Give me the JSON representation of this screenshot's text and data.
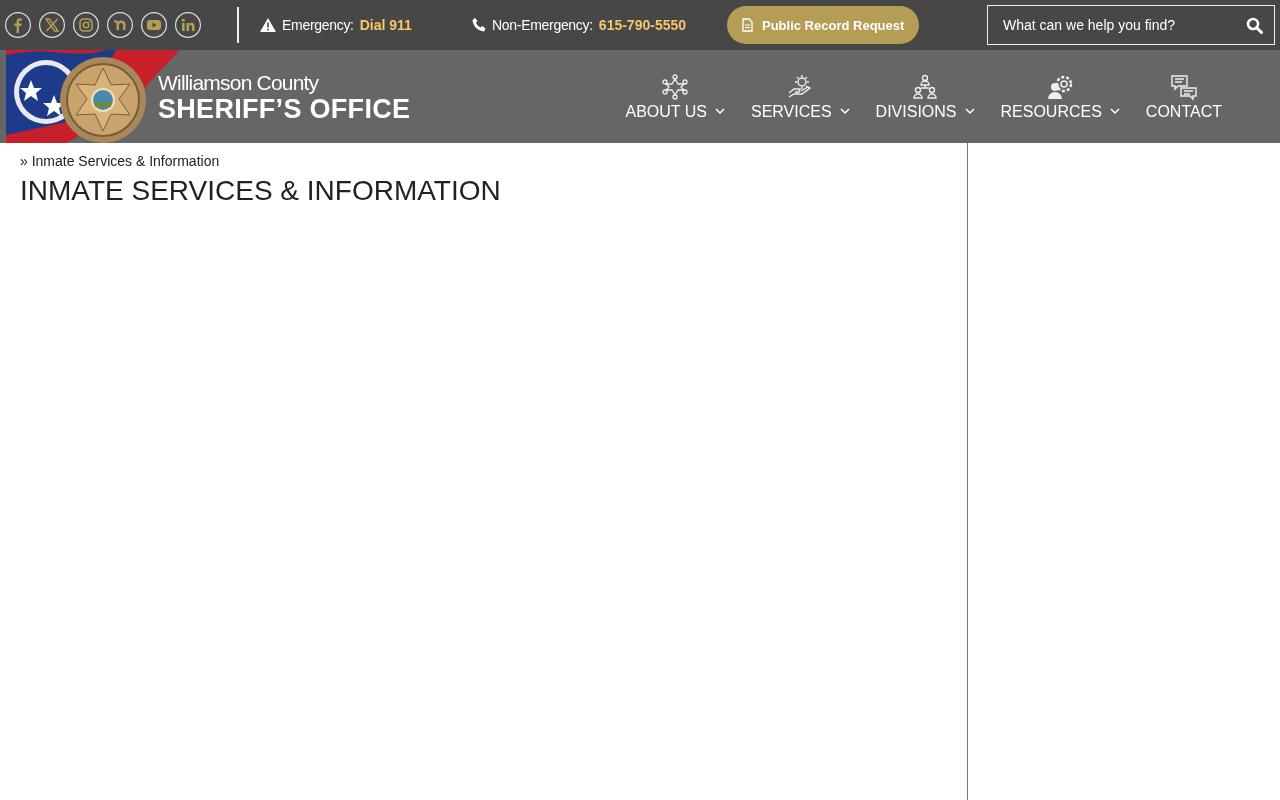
{
  "social_links": [
    {
      "kind": "facebook"
    },
    {
      "kind": "x"
    },
    {
      "kind": "instagram"
    },
    {
      "kind": "nextdoor"
    },
    {
      "kind": "youtube"
    },
    {
      "kind": "linkedin"
    }
  ],
  "emergency": {
    "label": "Emergency:",
    "value": "Dial 911"
  },
  "non_emergency": {
    "label": "Non-Emergency:",
    "value": "615-790-5550"
  },
  "record_button": {
    "label": "Public Record Request"
  },
  "search": {
    "placeholder": "What can we help you find?"
  },
  "logo": {
    "line_1": "Williamson County",
    "line_2": "SHERIFF’S OFFICE"
  },
  "nav": [
    {
      "label": "ABOUT US",
      "kind": "star",
      "dropdown": true
    },
    {
      "label": "SERVICES",
      "kind": "hand",
      "dropdown": true
    },
    {
      "label": "DIVISIONS",
      "kind": "org",
      "dropdown": true
    },
    {
      "label": "RESOURCES",
      "kind": "person-gear",
      "dropdown": true
    },
    {
      "label": "CONTACT",
      "kind": "chat",
      "dropdown": false
    }
  ],
  "breadcrumb": "» Inmate Services & Information",
  "page_title": "INMATE SERVICES & INFORMATION"
}
